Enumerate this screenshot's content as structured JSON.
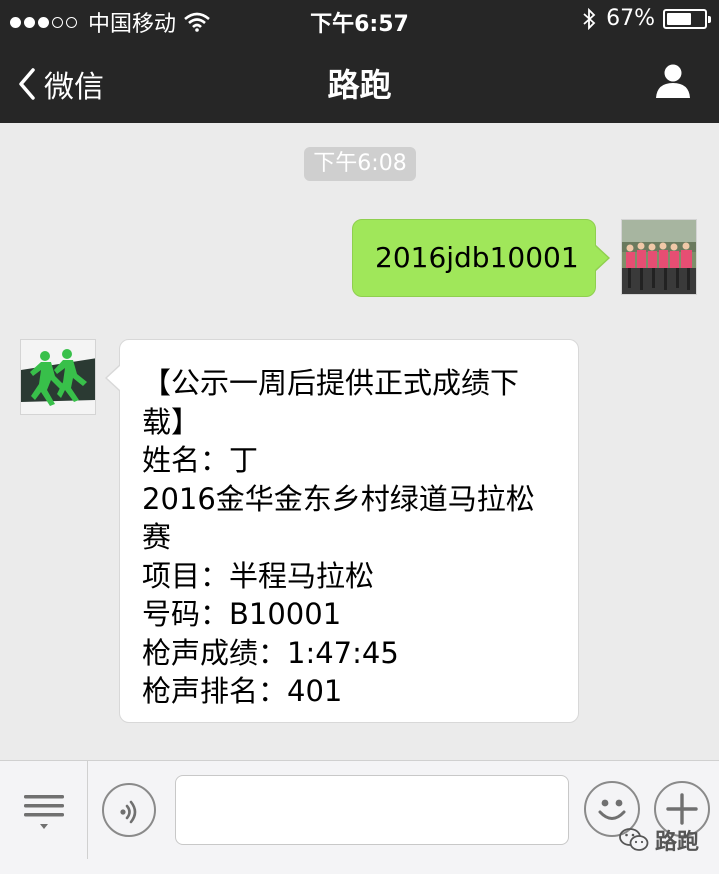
{
  "status_bar": {
    "carrier": "中国移动",
    "time": "下午6:57",
    "battery_percent": "67%",
    "battery_level": 0.67,
    "signal_bars_filled": 3,
    "signal_bars_total": 5
  },
  "nav": {
    "back_label": "微信",
    "title": "路跑",
    "back_icon": "chevron-left-icon",
    "profile_icon": "person-icon"
  },
  "chat": {
    "timestamp": "下午6:08",
    "outgoing_message": "2016jdb10001",
    "incoming_message_lines": [
      "【公示一周后提供正式成绩下",
      "载】",
      "姓名：丁",
      "2016金华金东乡村绿道马拉松",
      "赛",
      "项目：半程马拉松",
      "号码：B10001",
      "枪声成绩：1:47:45",
      "枪声排名：401"
    ]
  },
  "input_bar": {
    "menu_icon": "menu-list-icon",
    "voice_icon": "voice-icon",
    "text_value": "",
    "emoji_icon": "emoji-icon",
    "plus_icon": "plus-icon"
  },
  "watermark": {
    "text": "路跑"
  },
  "colors": {
    "bar_background": "#262626",
    "chat_background": "#ebebeb",
    "outgoing_bubble": "#a0e75a",
    "incoming_bubble": "#ffffff"
  }
}
